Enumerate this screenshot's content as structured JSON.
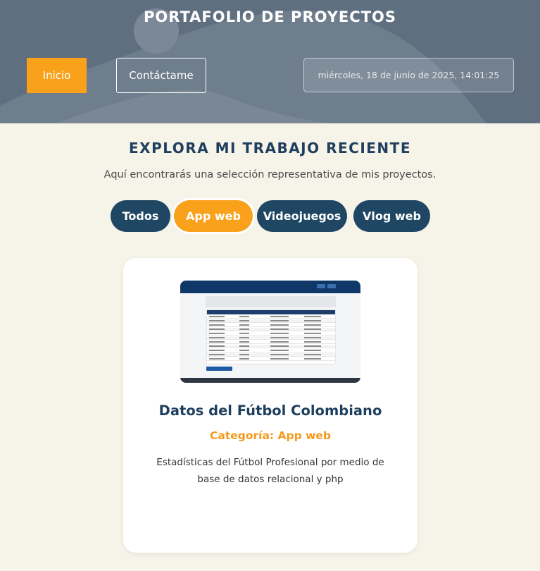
{
  "header": {
    "title": "PORTAFOLIO DE PROYECTOS",
    "nav": {
      "inicio_label": "Inicio",
      "contact_label": "Contáctame"
    },
    "datetime": "miércoles, 18 de junio de 2025, 14:01:25"
  },
  "section": {
    "title": "EXPLORA MI TRABAJO RECIENTE",
    "subtitle": "Aquí encontrarás una selección representativa de mis proyectos."
  },
  "filters": [
    {
      "label": "Todos",
      "active": false
    },
    {
      "label": "App web",
      "active": true
    },
    {
      "label": "Videojuegos",
      "active": false
    },
    {
      "label": "Vlog web",
      "active": false
    }
  ],
  "project": {
    "title": "Datos del Fútbol Colombiano",
    "category": "Categoría: App web",
    "description": "Estadísticas del Fútbol Profesional por medio de base de datos relacional y php"
  },
  "colors": {
    "accent": "#f9a11b",
    "navy": "#1f4764",
    "header_bg": "#5f6f80",
    "page_bg": "#f6f3e8"
  }
}
